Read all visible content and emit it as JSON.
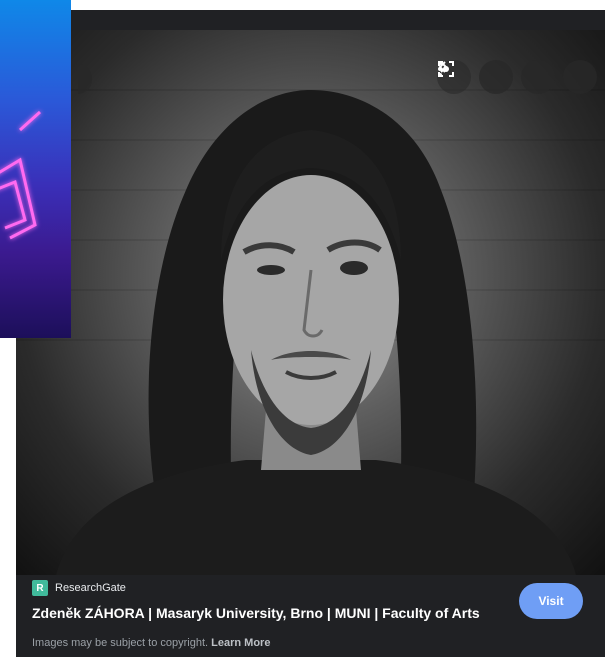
{
  "viewer": {
    "toolbar": {
      "lens_icon": "lens-icon",
      "more_icon": "more-vert-icon",
      "prev_icon": "chevron-left-icon",
      "next_icon": "chevron-right-icon"
    }
  },
  "result": {
    "source": {
      "logo_text": "R",
      "name": "ResearchGate",
      "logo_color": "#40ba9b"
    },
    "title": "Zdeněk ZÁHORA | Masaryk University, Brno | MUNI | Faculty of Arts",
    "visit_label": "Visit",
    "copyright_text": "Images may be subject to copyright.",
    "learn_more_label": "Learn More"
  },
  "colors": {
    "panel_bg": "#202124",
    "visit_button": "#6f9ef5",
    "text_primary": "#ffffff",
    "text_secondary": "#9aa0a6"
  }
}
